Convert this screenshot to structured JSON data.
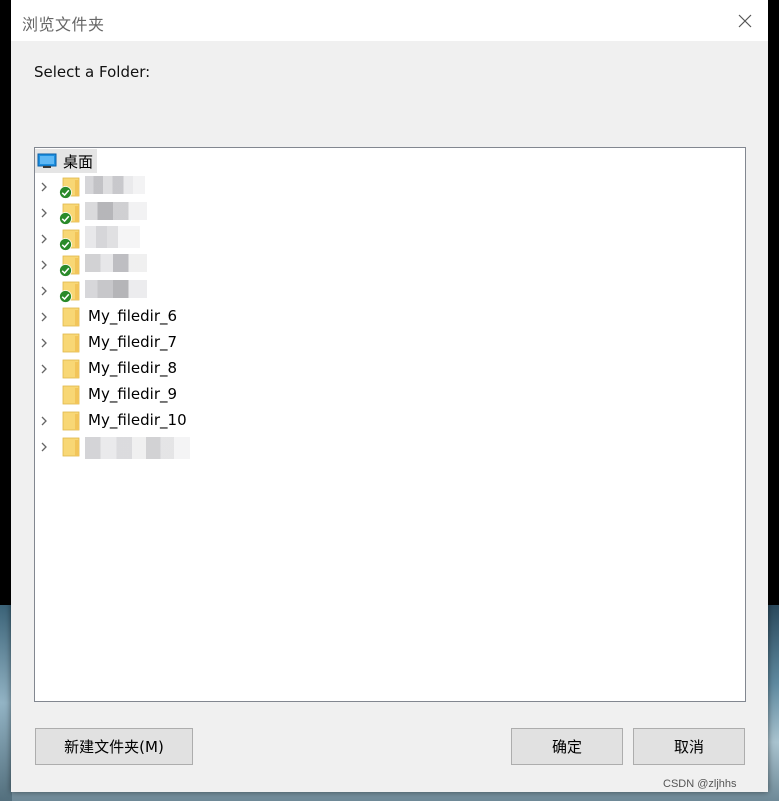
{
  "window": {
    "title": "浏览文件夹",
    "close_label": "×"
  },
  "prompt": "Select a Folder:",
  "tree": {
    "root": {
      "label": "桌面",
      "icon": "desktop-icon"
    },
    "nodes": [
      {
        "label": "",
        "redacted": true,
        "synced": true,
        "expandable": true
      },
      {
        "label": "",
        "redacted": true,
        "synced": true,
        "expandable": true
      },
      {
        "label": "",
        "redacted": true,
        "synced": true,
        "expandable": true
      },
      {
        "label": "",
        "redacted": true,
        "synced": true,
        "expandable": true
      },
      {
        "label": "",
        "redacted": true,
        "synced": true,
        "expandable": true
      },
      {
        "label": "My_filedir_6",
        "expandable": true
      },
      {
        "label": "My_filedir_7",
        "expandable": true
      },
      {
        "label": "My_filedir_8",
        "expandable": true
      },
      {
        "label": "My_filedir_9",
        "expandable": false
      },
      {
        "label": "My_filedir_10",
        "expandable": true
      },
      {
        "label": "",
        "redacted": true,
        "expandable": true
      }
    ]
  },
  "buttons": {
    "new_folder": "新建文件夹(M)",
    "ok": "确定",
    "cancel": "取消"
  },
  "watermark": "CSDN @zljhhs",
  "colors": {
    "folder": "#f8d775",
    "synced_badge": "#2a8a2a",
    "selection": "#e5e5e5",
    "desktop_icon": "#1e90e0"
  }
}
